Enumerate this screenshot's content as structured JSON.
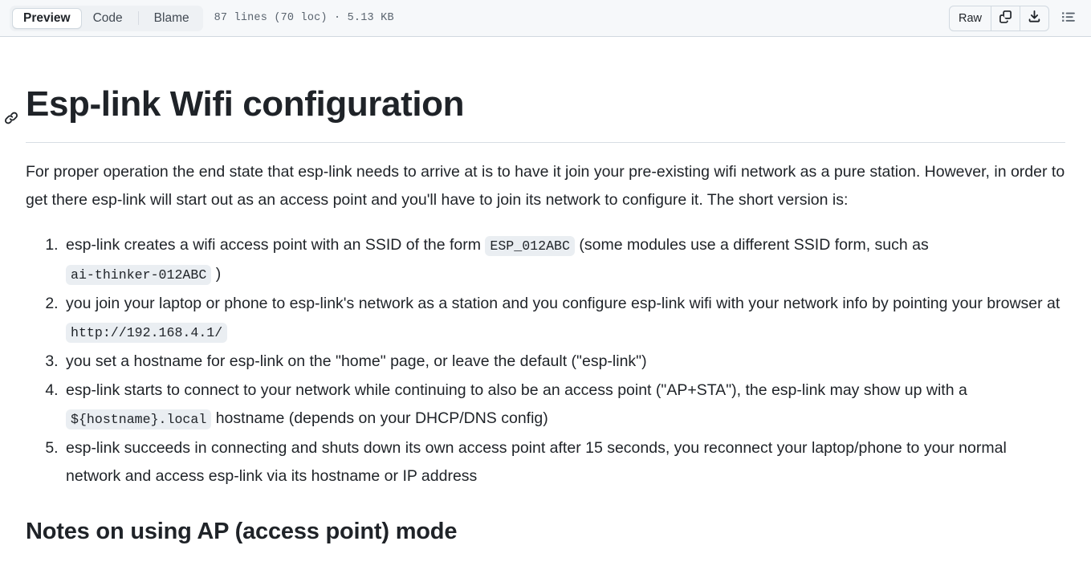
{
  "toolbar": {
    "tabs": [
      {
        "label": "Preview",
        "selected": true
      },
      {
        "label": "Code",
        "selected": false
      },
      {
        "label": "Blame",
        "selected": false
      }
    ],
    "file_meta": "87 lines (70 loc) · 5.13 KB",
    "raw_label": "Raw",
    "copy_icon": "copy-icon",
    "download_icon": "download-icon",
    "outline_icon": "outline-list-icon"
  },
  "article": {
    "anchor_icon": "link-anchor-icon",
    "title": "Esp-link Wifi configuration",
    "lead": "For proper operation the end state that esp-link needs to arrive at is to have it join your pre-existing wifi network as a pure station. However, in order to get there esp-link will start out as an access point and you'll have to join its network to configure it. The short version is:",
    "steps": [
      {
        "parts": [
          {
            "type": "text",
            "value": "esp-link creates a wifi access point with an SSID of the form "
          },
          {
            "type": "code",
            "value": "ESP_012ABC"
          },
          {
            "type": "text",
            "value": " (some modules use a different SSID form, such as "
          },
          {
            "type": "code",
            "value": "ai-thinker-012ABC"
          },
          {
            "type": "text",
            "value": " )"
          }
        ]
      },
      {
        "parts": [
          {
            "type": "text",
            "value": "you join your laptop or phone to esp-link's network as a station and you configure esp-link wifi with your network info by pointing your browser at "
          },
          {
            "type": "code",
            "value": "http://192.168.4.1/"
          }
        ]
      },
      {
        "parts": [
          {
            "type": "text",
            "value": "you set a hostname for esp-link on the \"home\" page, or leave the default (\"esp-link\")"
          }
        ]
      },
      {
        "parts": [
          {
            "type": "text",
            "value": "esp-link starts to connect to your network while continuing to also be an access point (\"AP+STA\"), the esp-link may show up with a "
          },
          {
            "type": "code",
            "value": "${hostname}.local"
          },
          {
            "type": "text",
            "value": " hostname (depends on your DHCP/DNS config)"
          }
        ]
      },
      {
        "parts": [
          {
            "type": "text",
            "value": "esp-link succeeds in connecting and shuts down its own access point after 15 seconds, you reconnect your laptop/phone to your normal network and access esp-link via its hostname or IP address"
          }
        ]
      }
    ],
    "section_title": "Notes on using AP (access point) mode"
  },
  "colors": {
    "toolbar_bg": "#f6f8fa",
    "border": "#d1d9e0",
    "text": "#1f2328",
    "muted_text": "#59636e",
    "code_bg": "#eaeef2"
  }
}
